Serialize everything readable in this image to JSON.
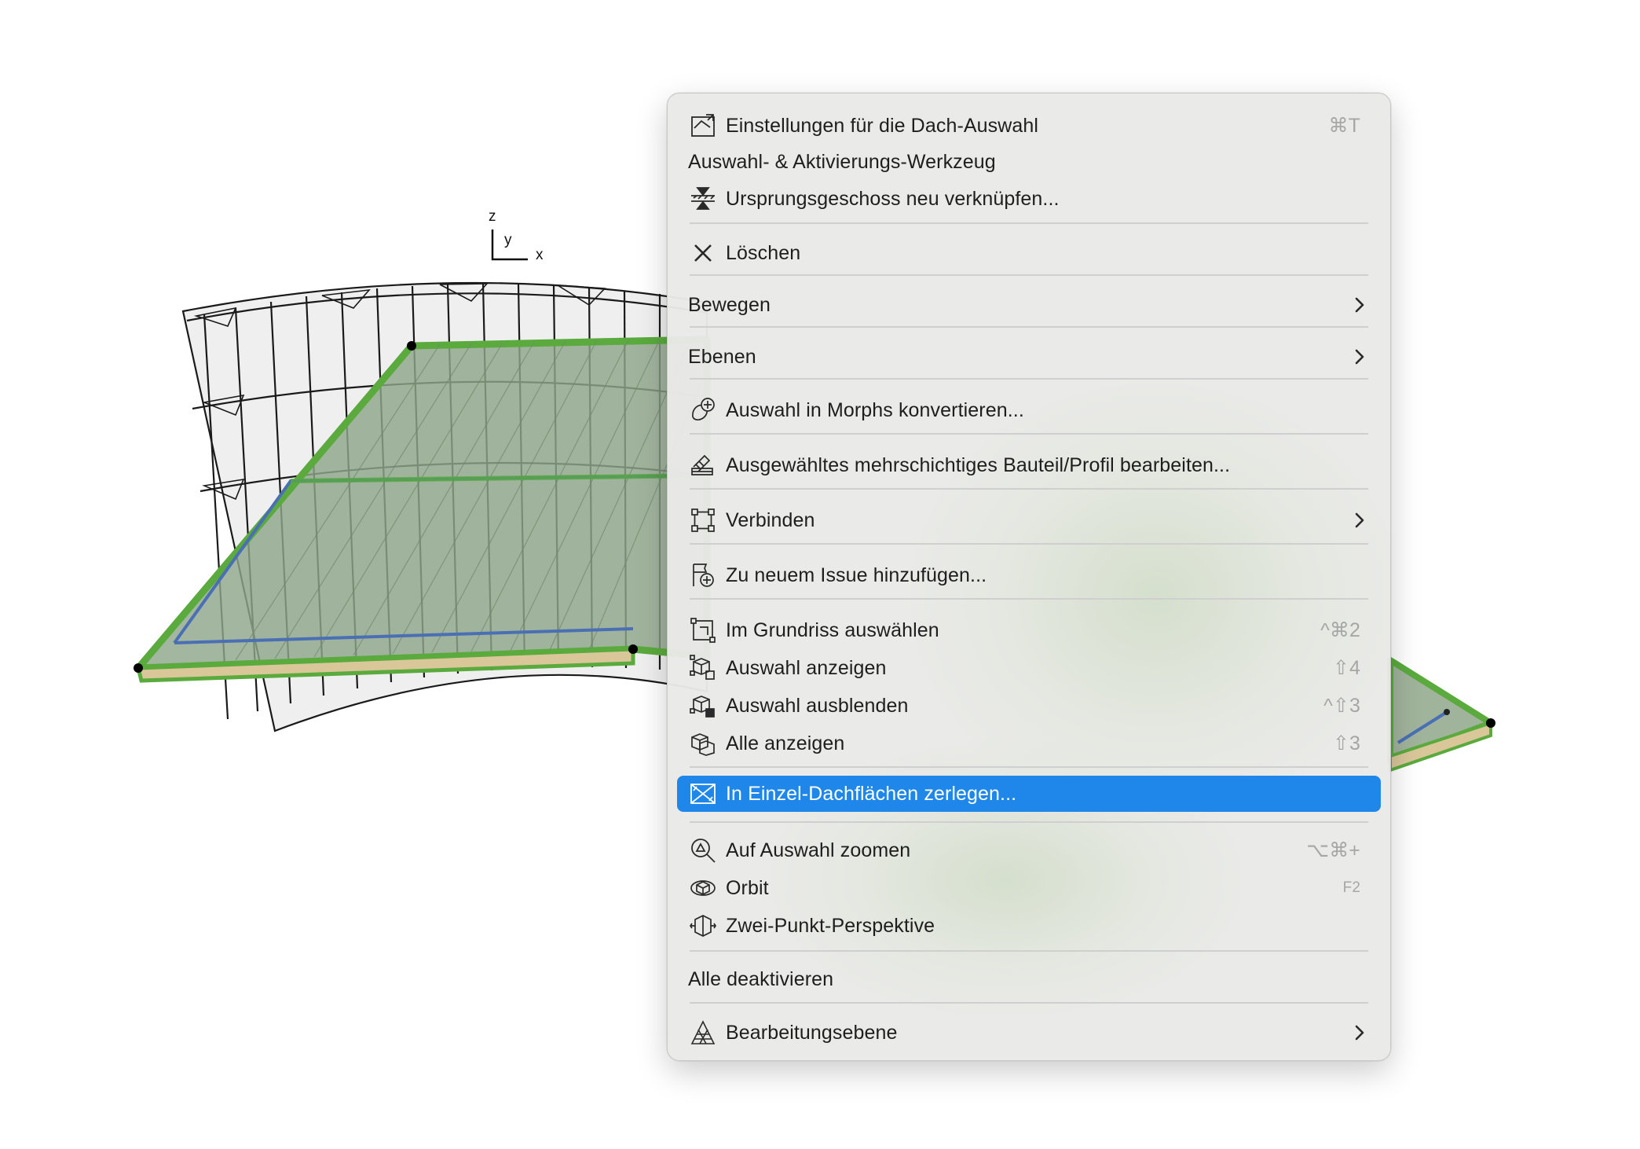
{
  "axes": {
    "z": "z",
    "y": "y",
    "x": "x"
  },
  "colors": {
    "menu_background": "#e9e9e7",
    "highlight": "#1f87e9",
    "roof_fill": "#8fa68a",
    "roof_edge": "#5aaa3e",
    "roof_axis": "#4a6fb5",
    "frame_lines": "#1a1a1a",
    "shortcut_text": "#a6a6a6"
  },
  "menu": {
    "items": [
      {
        "label": "Einstellungen für die Dach-Auswahl",
        "shortcut": "⌘T",
        "icon": "roof-settings-icon"
      },
      {
        "label": "Auswahl- & Aktivierungs-Werkzeug"
      },
      {
        "label": "Ursprungsgeschoss neu verknüpfen...",
        "icon": "relink-story-icon"
      },
      {
        "label": "Löschen",
        "icon": "delete-x-icon"
      },
      {
        "label": "Bewegen",
        "submenu": true
      },
      {
        "label": "Ebenen",
        "submenu": true
      },
      {
        "label": "Auswahl in Morphs konvertieren...",
        "icon": "morph-convert-icon"
      },
      {
        "label": "Ausgewähltes mehrschichtiges Bauteil/Profil bearbeiten...",
        "icon": "composite-edit-icon"
      },
      {
        "label": "Verbinden",
        "submenu": true,
        "icon": "connect-icon"
      },
      {
        "label": "Zu neuem Issue hinzufügen...",
        "icon": "add-issue-icon"
      },
      {
        "label": "Im Grundriss auswählen",
        "shortcut": "^⌘2",
        "icon": "select-in-plan-icon"
      },
      {
        "label": "Auswahl anzeigen",
        "shortcut": "⇧4",
        "icon": "show-selection-icon"
      },
      {
        "label": "Auswahl ausblenden",
        "shortcut": "^⇧3",
        "icon": "hide-selection-icon"
      },
      {
        "label": "Alle anzeigen",
        "shortcut": "⇧3",
        "icon": "show-all-icon"
      },
      {
        "label": "In Einzel-Dachflächen zerlegen...",
        "icon": "explode-roof-icon",
        "highlighted": true
      },
      {
        "label": "Auf Auswahl zoomen",
        "shortcut": "⌥⌘+",
        "icon": "zoom-selection-icon"
      },
      {
        "label": "Orbit",
        "shortcut": "F2",
        "icon": "orbit-icon"
      },
      {
        "label": "Zwei-Punkt-Perspektive",
        "icon": "two-point-perspective-icon"
      },
      {
        "label": "Alle deaktivieren"
      },
      {
        "label": "Bearbeitungsebene",
        "submenu": true,
        "icon": "editing-plane-icon"
      }
    ]
  }
}
